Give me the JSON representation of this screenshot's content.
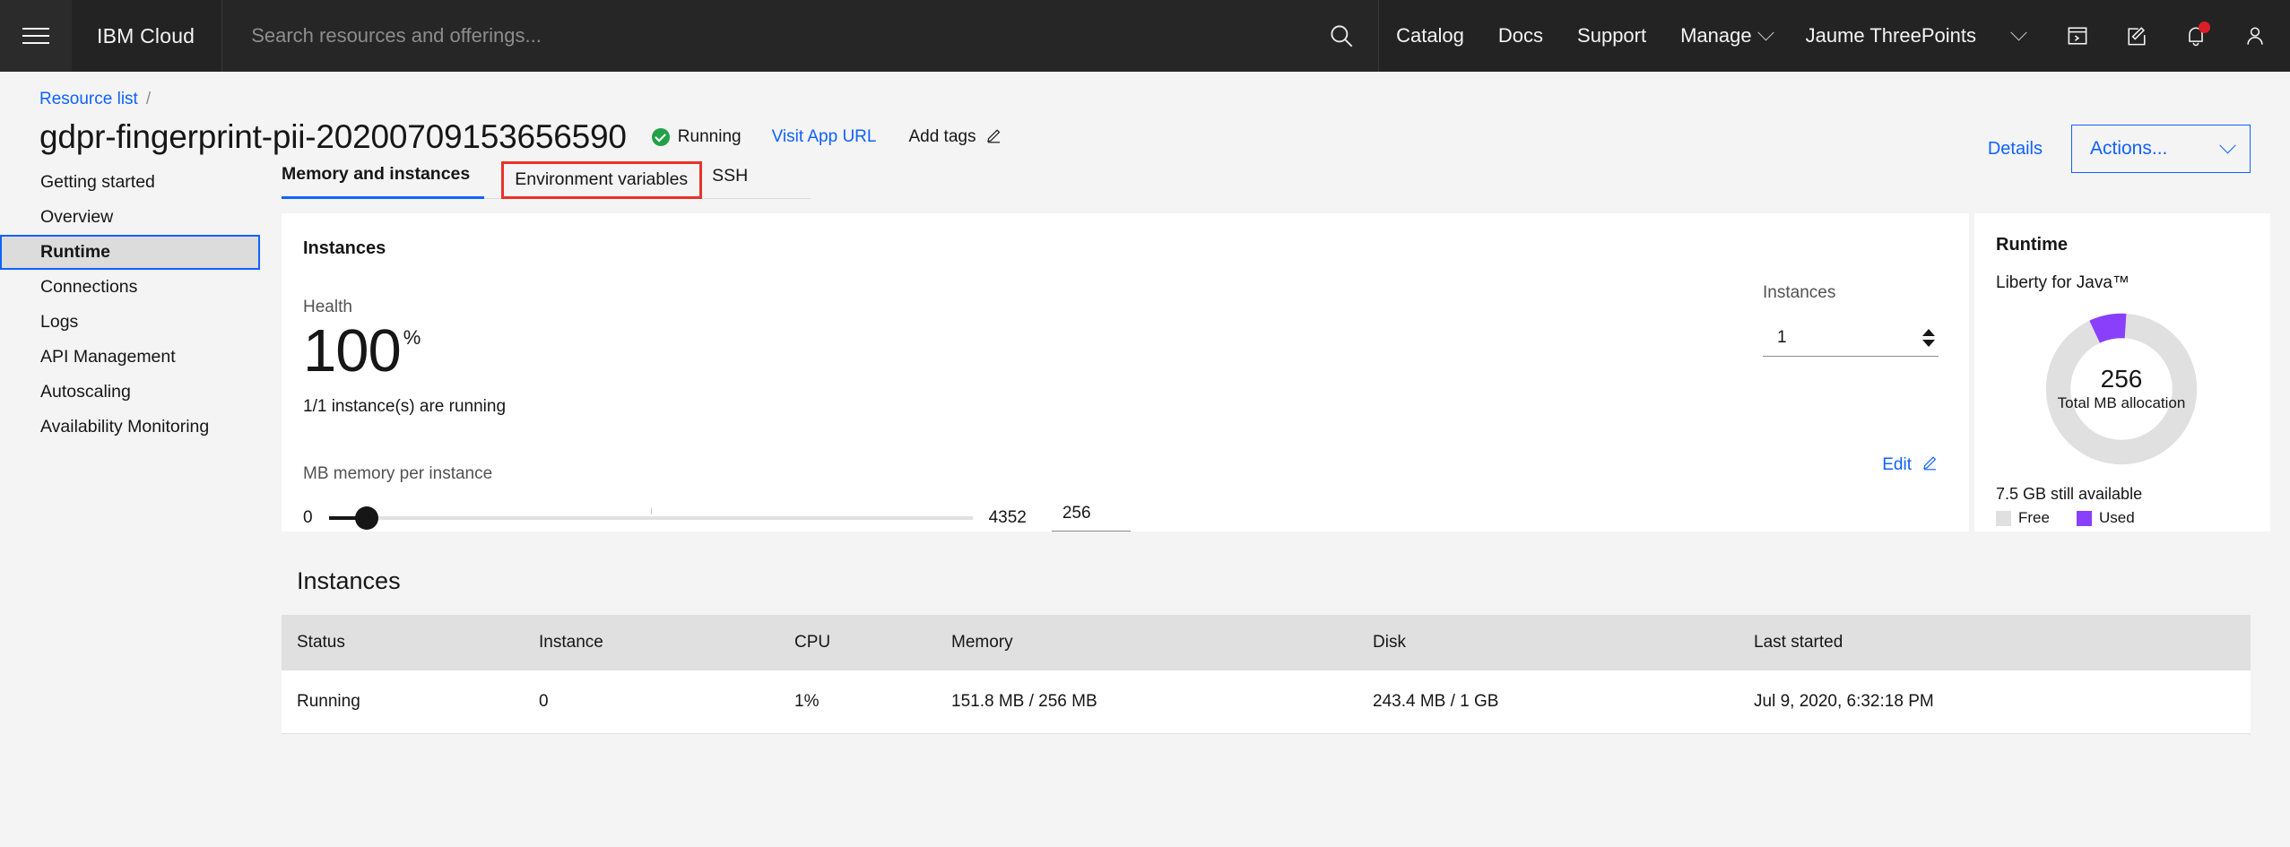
{
  "header": {
    "menu_icon": "hamburger-menu-icon",
    "brand": "IBM Cloud",
    "search": {
      "placeholder": "Search resources and offerings...",
      "value": "",
      "icon": "search-icon"
    },
    "nav": [
      {
        "label": "Catalog",
        "has_caret": false
      },
      {
        "label": "Docs",
        "has_caret": false
      },
      {
        "label": "Support",
        "has_caret": false
      },
      {
        "label": "Manage",
        "has_caret": true
      }
    ],
    "account": {
      "label": "Jaume ThreePoints",
      "caret_icon": "chevron-down-icon"
    },
    "icons": [
      {
        "name": "shell-terminal-icon"
      },
      {
        "name": "create-resource-edit-icon"
      },
      {
        "name": "notifications-bell-icon",
        "badge": true
      },
      {
        "name": "user-avatar-icon"
      }
    ]
  },
  "breadcrumb": {
    "root": "Resource list",
    "separator": "/"
  },
  "title": {
    "name": "gdpr-fingerprint-pii-20200709153656590",
    "status": "Running",
    "visit_url_label": "Visit App URL",
    "add_tags_label": "Add tags",
    "add_tags_icon": "edit-pencil-icon"
  },
  "title_actions": {
    "details_label": "Details",
    "actions_label": "Actions...",
    "actions_caret": "chevron-down-icon"
  },
  "sidebar": {
    "items": [
      {
        "label": "Getting started",
        "active": false
      },
      {
        "label": "Overview",
        "active": false
      },
      {
        "label": "Runtime",
        "active": true
      },
      {
        "label": "Connections",
        "active": false
      },
      {
        "label": "Logs",
        "active": false
      },
      {
        "label": "API Management",
        "active": false
      },
      {
        "label": "Autoscaling",
        "active": false
      },
      {
        "label": "Availability Monitoring",
        "active": false
      }
    ]
  },
  "tabs": [
    {
      "label": "Memory and instances",
      "active": true,
      "highlighted": false
    },
    {
      "label": "Environment variables",
      "active": false,
      "highlighted": true
    },
    {
      "label": "SSH",
      "active": false,
      "highlighted": false
    }
  ],
  "instances_panel": {
    "heading": "Instances",
    "edit_label": "Edit",
    "edit_icon": "edit-pencil-icon",
    "health_label": "Health",
    "health_value": "100",
    "health_unit": "%",
    "health_sub": "1/1 instance(s) are running",
    "memory_label": "MB memory per instance",
    "slider_min": "0",
    "slider_max": "4352",
    "slider_value": "256",
    "slider_percent": 5.9,
    "stepper_label": "Instances",
    "stepper_value": "1",
    "stepper_icon": "up-down-spinner-icon"
  },
  "runtime_panel": {
    "heading": "Runtime",
    "subtitle": "Liberty for Java™",
    "available_text": "7.5 GB still available",
    "legend": [
      {
        "label": "Free",
        "color": "#e0e0e0"
      },
      {
        "label": "Used",
        "color": "#8a3ffc"
      }
    ]
  },
  "chart_data": {
    "type": "pie",
    "title": "Runtime",
    "subtitle": "Liberty for Java™",
    "center_value": "256",
    "center_label": "Total MB allocation",
    "categories": [
      "Free",
      "Used"
    ],
    "values": [
      92,
      8
    ],
    "unit": "%",
    "colors": [
      "#e0e0e0",
      "#8a3ffc"
    ],
    "legend_position": "bottom",
    "annotation": "7.5 GB still available",
    "donut": true
  },
  "instances_table": {
    "title": "Instances",
    "columns": [
      "Status",
      "Instance",
      "CPU",
      "Memory",
      "Disk",
      "Last started"
    ],
    "rows": [
      {
        "status": "Running",
        "instance": "0",
        "cpu": "1%",
        "memory": "151.8 MB / 256 MB",
        "disk": "243.4 MB / 1 GB",
        "last_started": "Jul 9, 2020, 6:32:18 PM"
      }
    ]
  }
}
